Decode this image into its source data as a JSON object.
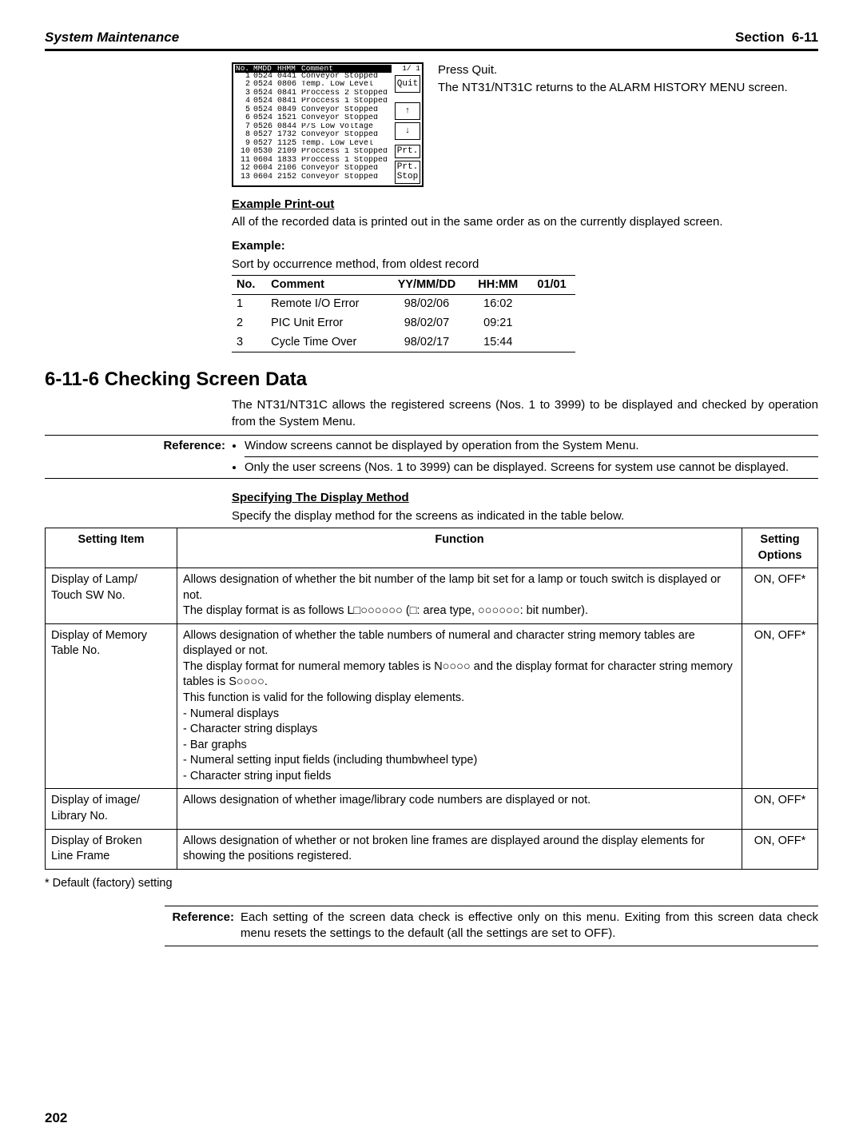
{
  "header": {
    "left": "System Maintenance",
    "right_label": "Section",
    "right_num": "6-11"
  },
  "device": {
    "pagecounter": "1/ 1",
    "cols": {
      "no": "No.",
      "mmdd": "MMDD",
      "hhmm": "HHMM",
      "comment": "Comment"
    },
    "rows": [
      {
        "no": "1",
        "md": "0524",
        "hm": "0441",
        "cm": "Conveyor Stopped"
      },
      {
        "no": "2",
        "md": "0524",
        "hm": "0806",
        "cm": "Temp. Low Level"
      },
      {
        "no": "3",
        "md": "0524",
        "hm": "0841",
        "cm": "Proccess 2 Stopped"
      },
      {
        "no": "4",
        "md": "0524",
        "hm": "0841",
        "cm": "Proccess 1 Stopped"
      },
      {
        "no": "5",
        "md": "0524",
        "hm": "0849",
        "cm": "Conveyor Stopped"
      },
      {
        "no": "6",
        "md": "0524",
        "hm": "1521",
        "cm": "Conveyor Stopped"
      },
      {
        "no": "7",
        "md": "0526",
        "hm": "0844",
        "cm": "P/S Low Voltage"
      },
      {
        "no": "8",
        "md": "0527",
        "hm": "1732",
        "cm": "Conveyor Stopped"
      },
      {
        "no": "9",
        "md": "0527",
        "hm": "1125",
        "cm": "Temp. Low Level"
      },
      {
        "no": "10",
        "md": "0530",
        "hm": "2109",
        "cm": "Proccess 1 Stopped"
      },
      {
        "no": "11",
        "md": "0604",
        "hm": "1833",
        "cm": "Proccess 1 Stopped"
      },
      {
        "no": "12",
        "md": "0604",
        "hm": "2106",
        "cm": "Conveyor Stopped"
      },
      {
        "no": "13",
        "md": "0604",
        "hm": "2152",
        "cm": "Conveyor Stopped"
      }
    ],
    "side": {
      "quit": "Quit",
      "up": "↑",
      "down": "↓",
      "prt": "Prt.",
      "prtstop": "Prt.\nStop"
    }
  },
  "sidecopy": {
    "l1": "Press Quit.",
    "l2": "The NT31/NT31C returns to the ALARM HISTORY MENU screen."
  },
  "example": {
    "head": "Example Print-out",
    "para": "All of the recorded data is printed out in the same order as on the currently displayed screen.",
    "head2": "Example:",
    "para2": "Sort by occurrence method, from oldest record",
    "thead": {
      "no": "No.",
      "comment": "Comment",
      "date": "YY/MM/DD",
      "time": "HH:MM",
      "page": "01/01"
    },
    "rows": [
      {
        "n": "1",
        "c": "Remote I/O Error",
        "d": "98/02/06",
        "t": "16:02"
      },
      {
        "n": "2",
        "c": "PIC Unit Error",
        "d": "98/02/07",
        "t": "09:21"
      },
      {
        "n": "3",
        "c": "Cycle Time Over",
        "d": "98/02/17",
        "t": "15:44"
      }
    ]
  },
  "section": {
    "title": "6-11-6 Checking Screen Data",
    "intro": "The NT31/NT31C allows the registered screens (Nos. 1 to 3999) to be displayed and checked by operation from the System Menu.",
    "ref_label": "Reference:",
    "refs": [
      "Window screens cannot be displayed by operation from the System Menu.",
      "Only the user screens (Nos. 1 to 3999) can be displayed. Screens for system use cannot be displayed."
    ],
    "spec_head": "Specifying The Display Method",
    "spec_para": "Specify the display method for the screens as indicated in the table below."
  },
  "settings": {
    "head": {
      "item": "Setting Item",
      "func": "Function",
      "opt": "Setting Options"
    },
    "rows": [
      {
        "item": "Display of Lamp/\nTouch SW No.",
        "func": "Allows designation of whether the bit number of the lamp bit set for a lamp or touch switch is displayed or not.\nThe display format is as follows L□○○○○○○ (□: area type, ○○○○○○: bit number).",
        "opt": "ON, OFF*"
      },
      {
        "item": "Display of Memory\nTable No.",
        "func": "Allows designation of whether the table numbers of numeral and character string memory tables are displayed or not.\nThe display format for numeral memory tables is N○○○○ and the display format for character string memory tables is S○○○○.\nThis function is valid for the following display elements.\n- Numeral displays\n- Character string displays\n- Bar graphs\n- Numeral setting input fields (including thumbwheel type)\n- Character string input fields",
        "opt": "ON, OFF*"
      },
      {
        "item": "Display of image/\nLibrary No.",
        "func": "Allows designation of whether image/library code numbers are displayed or not.",
        "opt": "ON, OFF*"
      },
      {
        "item": "Display of Broken\nLine Frame",
        "func": "Allows designation of whether or not broken line frames are displayed around the display elements for showing the positions registered.",
        "opt": "ON, OFF*"
      }
    ],
    "foot": "* Default (factory) setting"
  },
  "bottom_ref": {
    "label": "Reference:",
    "text": "Each setting of the screen data check is effective only on this menu. Exiting from this screen data check menu resets the settings to the default (all the settings are set to OFF)."
  },
  "pagenum": "202"
}
